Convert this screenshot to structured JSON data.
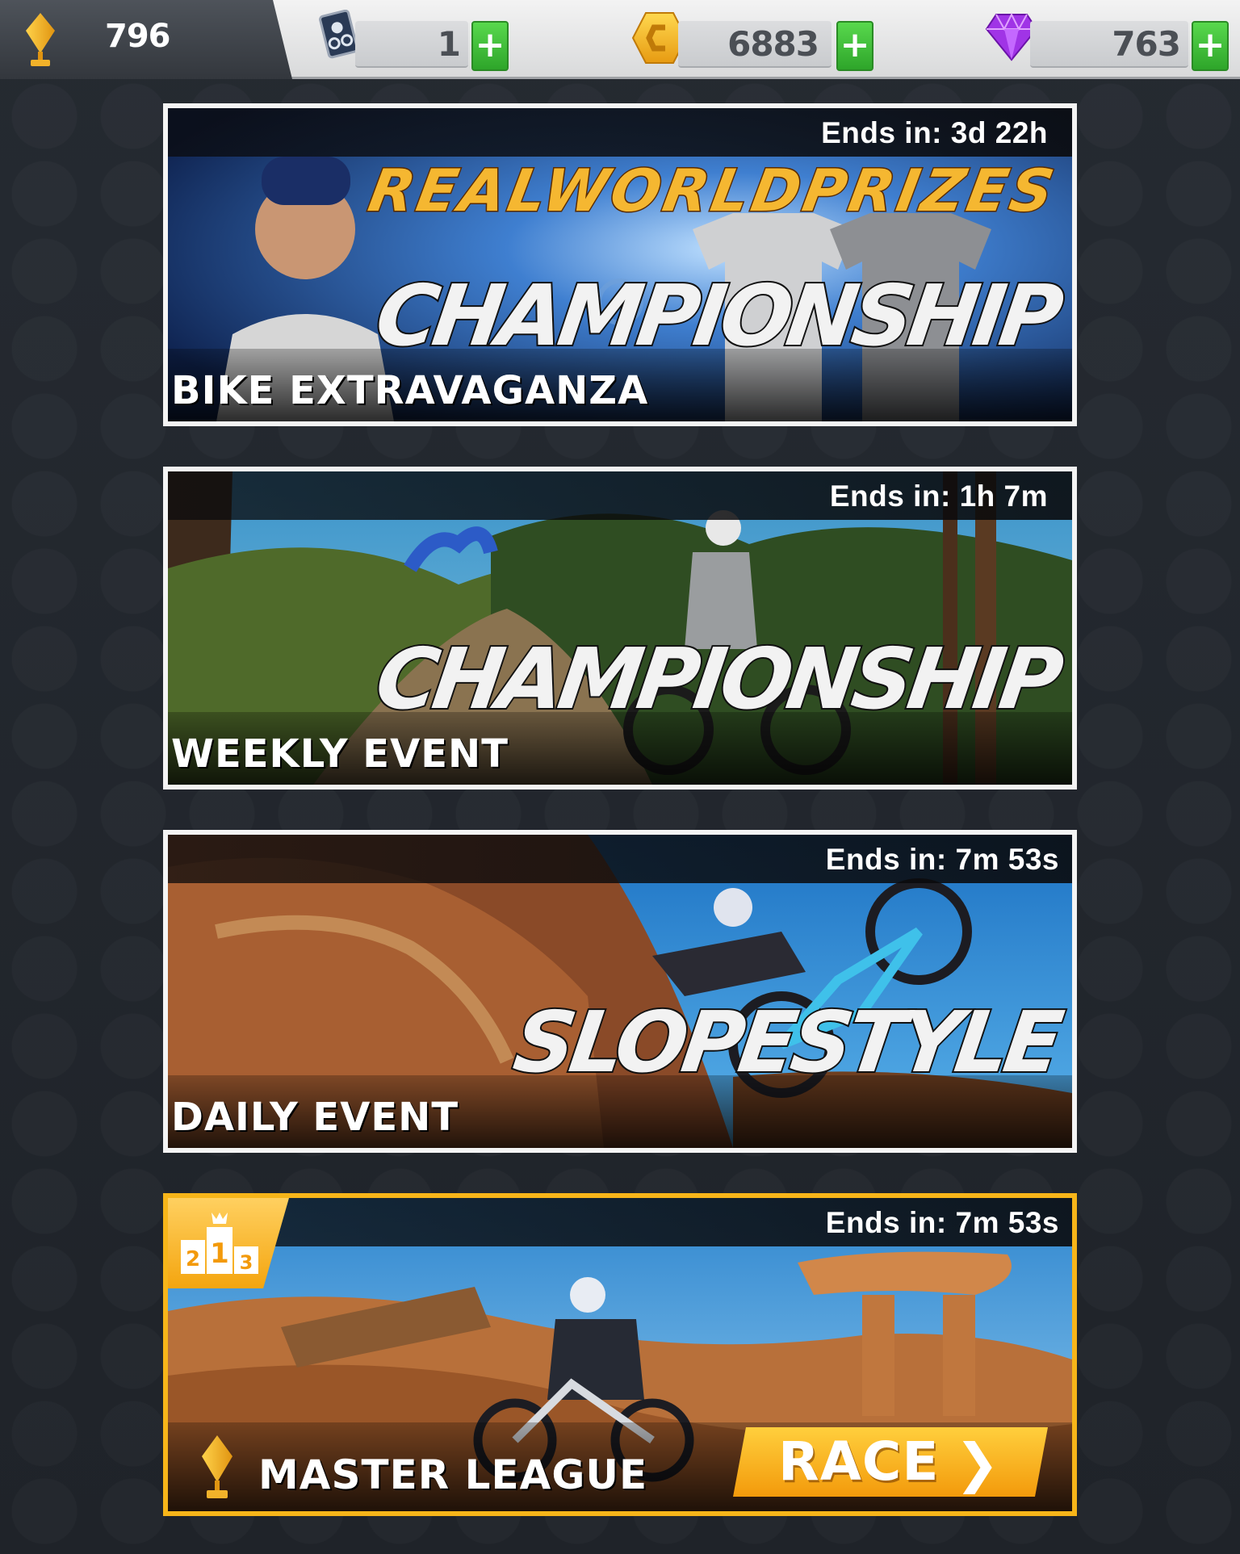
{
  "topbar": {
    "trophies": "796",
    "cards": "1",
    "coins": "6883",
    "gems": "763",
    "plus_label": "+"
  },
  "icons": {
    "trophy": "trophy-icon",
    "card": "rider-card-icon",
    "coin": "coin-icon",
    "gem": "gem-icon",
    "chevron": "chevron-right-icon"
  },
  "colors": {
    "accent_green": "#3dbb33",
    "accent_gold": "#f7b519",
    "gem_purple": "#a034e6",
    "background": "#23272e"
  },
  "events": [
    {
      "timer": "Ends in: 3d 22h",
      "promo": "REALWORLDPRIZES",
      "title": "CHAMPIONSHIP",
      "subtitle": "BIKE EXTRAVAGANZA"
    },
    {
      "timer": "Ends in: 1h 7m",
      "title": "CHAMPIONSHIP",
      "subtitle": "WEEKLY EVENT"
    },
    {
      "timer": "Ends in: 7m 53s",
      "title": "SLOPESTYLE",
      "subtitle": "DAILY EVENT"
    }
  ],
  "master": {
    "timer": "Ends in: 7m 53s",
    "label": "MASTER LEAGUE",
    "button": "RACE",
    "chevron": "❯",
    "podium": [
      "2",
      "1",
      "3"
    ]
  }
}
